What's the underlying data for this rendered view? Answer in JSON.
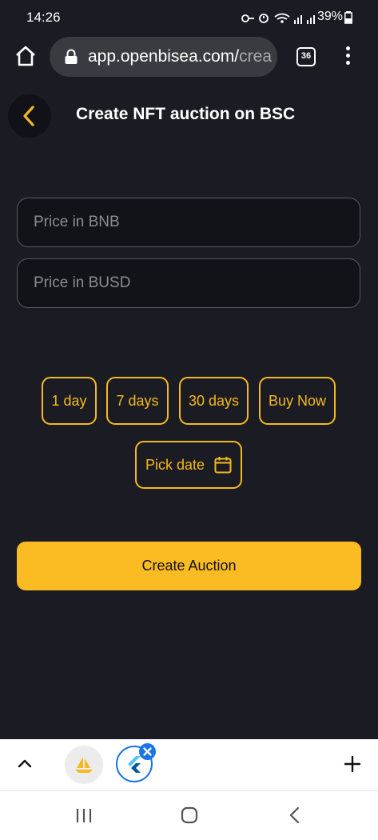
{
  "status_bar": {
    "time": "14:26",
    "battery": "39%"
  },
  "browser": {
    "url_main": "app.openbisea.com/",
    "url_faded": "crea",
    "tab_count": "36"
  },
  "page": {
    "title": "Create NFT auction on BSC"
  },
  "form": {
    "price_bnb_placeholder": "Price in BNB",
    "price_busd_placeholder": "Price in BUSD"
  },
  "durations": [
    "1 day",
    "7 days",
    "30 days",
    "Buy Now"
  ],
  "pick_date_label": "Pick date",
  "create_button_label": "Create Auction",
  "colors": {
    "accent": "#fbbc23",
    "background": "#1b1c23"
  }
}
